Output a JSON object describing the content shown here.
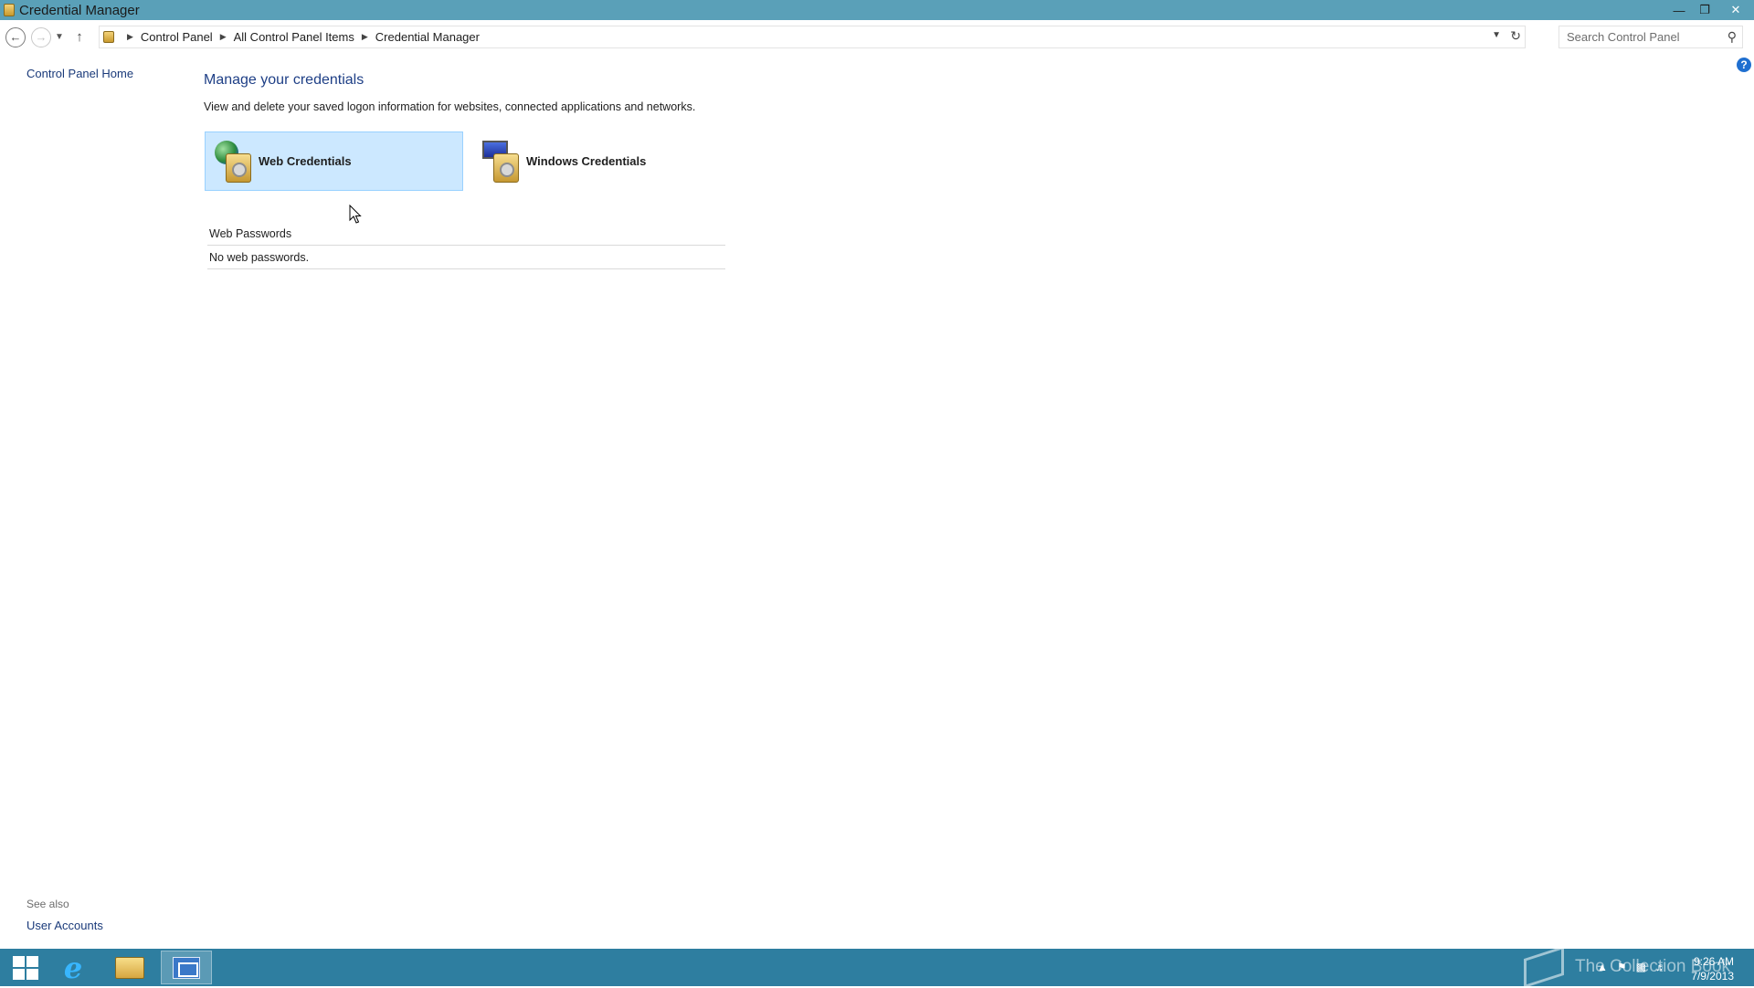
{
  "window": {
    "title": "Credential Manager"
  },
  "address_bar": {
    "crumbs": [
      "Control Panel",
      "All Control Panel Items",
      "Credential Manager"
    ],
    "search_placeholder": "Search Control Panel"
  },
  "sidebar": {
    "home_link": "Control Panel Home",
    "see_also_label": "See also",
    "see_also_links": [
      "User Accounts"
    ]
  },
  "main": {
    "title": "Manage your credentials",
    "description": "View and delete your saved logon information for websites, connected applications and networks.",
    "tiles": [
      {
        "label": "Web Credentials",
        "icon": "globe-vault-icon",
        "selected": true
      },
      {
        "label": "Windows Credentials",
        "icon": "monitor-vault-icon",
        "selected": false
      }
    ],
    "section": {
      "heading": "Web Passwords",
      "empty_text": "No web passwords."
    }
  },
  "taskbar": {
    "items": [
      "start-icon",
      "internet-explorer-icon",
      "file-explorer-icon",
      "control-panel-icon"
    ],
    "active_item": "control-panel-icon",
    "watermark": "The Collection Book",
    "clock": {
      "time": "9:26 AM",
      "date": "7/9/2013"
    }
  },
  "colors": {
    "titlebar": "#5aa0b8",
    "taskbar": "#2e7ea0",
    "link": "#1a3a7a",
    "heading": "#1e3f86",
    "selection": "#cce8ff"
  }
}
